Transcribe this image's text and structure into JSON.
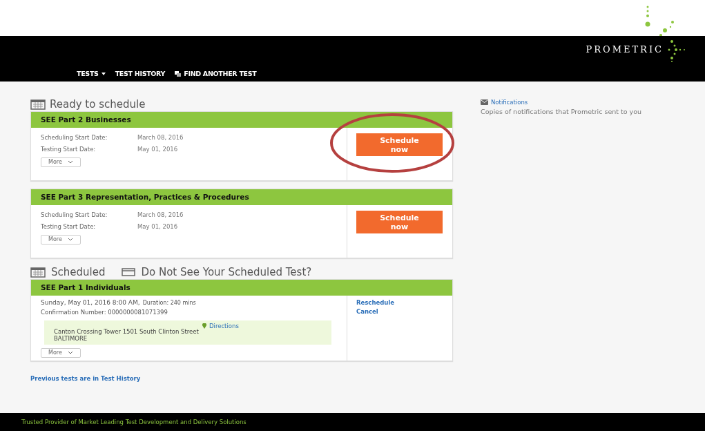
{
  "header": {
    "brand": "PROMETRIC",
    "nav": [
      {
        "label": "TESTS",
        "kind": "dropdown"
      },
      {
        "label": "TEST HISTORY",
        "kind": "link"
      },
      {
        "label": "FIND ANOTHER TEST",
        "kind": "icon"
      }
    ]
  },
  "ready": {
    "title": "Ready to schedule",
    "tests": [
      {
        "name": "SEE Part 2 Businesses",
        "fields": [
          {
            "label": "Scheduling Start Date:",
            "value": "March 08, 2016"
          },
          {
            "label": "Testing Start Date:",
            "value": "May 01, 2016"
          }
        ],
        "more": "More",
        "button": "Schedule now",
        "highlighted": true
      },
      {
        "name": "SEE Part 3 Representation, Practices & Procedures",
        "fields": [
          {
            "label": "Scheduling Start Date:",
            "value": "March 08, 2016"
          },
          {
            "label": "Testing Start Date:",
            "value": "May 01, 2016"
          }
        ],
        "more": "More",
        "button": "Schedule now",
        "highlighted": false
      }
    ]
  },
  "scheduled": {
    "title": "Scheduled",
    "help": "Do Not See Your Scheduled Test?",
    "tests": [
      {
        "name": "SEE Part 1 Individuals",
        "datetime": "Sunday, May 01, 2016 8:00 AM,",
        "duration": "Duration: 240 mins",
        "confirmation": "Confirmation Number: 0000000081071399",
        "address": "Canton Crossing Tower 1501 South Clinton Street BALTIMORE",
        "directions": "Directions",
        "more": "More",
        "actions": [
          "Reschedule",
          "Cancel"
        ]
      }
    ]
  },
  "history_link": "Previous tests are in Test History",
  "notifications": {
    "title": "Notifications",
    "text": "Copies of notifications that Prometric sent to you"
  },
  "footer": "Trusted Provider of Market Leading Test Development and Delivery Solutions"
}
